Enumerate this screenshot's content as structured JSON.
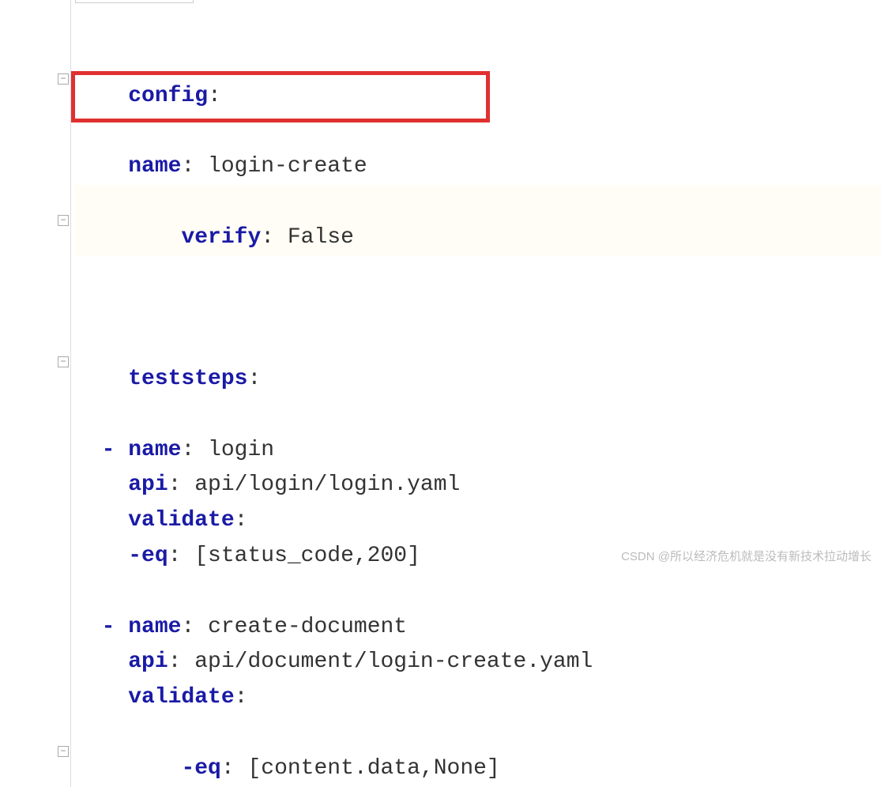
{
  "code": {
    "config_key": "config",
    "config_name_key": "name",
    "config_name_val": "login-create",
    "verify_key": "verify",
    "verify_val": "False",
    "teststeps_key": "teststeps",
    "step1": {
      "name_key": "name",
      "name_val": "login",
      "api_key": "api",
      "api_val": "api/login/login.yaml",
      "validate_key": "validate",
      "eq_key": "-eq",
      "eq_val": "[status_code,200]"
    },
    "step2": {
      "name_key": "name",
      "name_val": "create-document",
      "api_key": "api",
      "api_val": "api/document/login-create.yaml",
      "validate_key": "validate",
      "eq_key": "-eq",
      "eq_val": "[content.data,None]"
    }
  },
  "watermark": "CSDN @所以经济危机就是没有新技术拉动增长"
}
